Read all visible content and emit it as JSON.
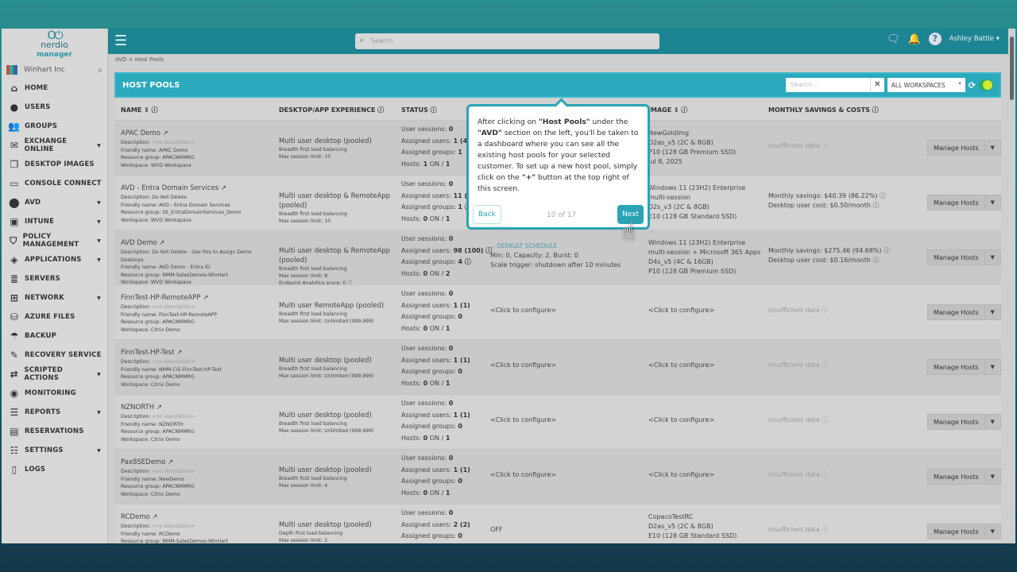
{
  "brand": {
    "logo_text": "nerdio",
    "logo_sub": "manager"
  },
  "tenant": "Winhart Inc",
  "nav": [
    {
      "label": "HOME",
      "icon": "⌂",
      "n": "home-icon"
    },
    {
      "label": "USERS",
      "icon": "●",
      "n": "user-icon"
    },
    {
      "label": "GROUPS",
      "icon": "👥",
      "n": "groups-icon"
    },
    {
      "label": "EXCHANGE ONLINE",
      "icon": "✉",
      "n": "mail-icon",
      "caret": true
    },
    {
      "label": "DESKTOP IMAGES",
      "icon": "❐",
      "n": "images-icon"
    },
    {
      "label": "CONSOLE CONNECT",
      "icon": "▭",
      "n": "monitor-icon"
    },
    {
      "label": "AVD",
      "icon": "⬤",
      "n": "avd-icon",
      "caret": true
    },
    {
      "label": "INTUNE",
      "icon": "▣",
      "n": "intune-icon",
      "caret": true
    },
    {
      "label": "POLICY MANAGEMENT",
      "icon": "⛉",
      "n": "shield-icon",
      "caret": true
    },
    {
      "label": "APPLICATIONS",
      "icon": "◈",
      "n": "apps-icon",
      "caret": true
    },
    {
      "label": "SERVERS",
      "icon": "≣",
      "n": "servers-icon"
    },
    {
      "label": "NETWORK",
      "icon": "⊞",
      "n": "network-icon",
      "caret": true
    },
    {
      "label": "AZURE FILES",
      "icon": "⛁",
      "n": "database-icon"
    },
    {
      "label": "BACKUP",
      "icon": "☂",
      "n": "umbrella-icon"
    },
    {
      "label": "RECOVERY SERVICE",
      "icon": "✎",
      "n": "wrench-icon"
    },
    {
      "label": "SCRIPTED ACTIONS",
      "icon": "⇄",
      "n": "scripts-icon",
      "caret": true
    },
    {
      "label": "MONITORING",
      "icon": "◉",
      "n": "monitoring-icon"
    },
    {
      "label": "REPORTS",
      "icon": "☰",
      "n": "reports-icon",
      "caret": true
    },
    {
      "label": "RESERVATIONS",
      "icon": "▤",
      "n": "reservations-icon"
    },
    {
      "label": "SETTINGS",
      "icon": "☷",
      "n": "settings-icon",
      "caret": true
    },
    {
      "label": "LOGS",
      "icon": "▯",
      "n": "logs-icon"
    }
  ],
  "topbar": {
    "search_placeholder": "Search",
    "user": "Ashley Battle"
  },
  "breadcrumb": "AVD  >  Host Pools",
  "panel": {
    "title": "HOST POOLS",
    "search_placeholder": "Search...",
    "workspace": "ALL WORKSPACES"
  },
  "columns": [
    "NAME ⇕ ⓘ",
    "DESKTOP/APP EXPERIENCE ⓘ",
    "STATUS ⓘ",
    "IMAGE ⇕ ⓘ",
    "MONTHLY SAVINGS & COSTS ⓘ"
  ],
  "manage_label": "Manage Hosts",
  "rows": [
    {
      "name": "APAC Demo",
      "desc": "<no description>",
      "nodesc": true,
      "friendly": "Friendly name: APAC Demo",
      "rg": "Resource group: APACNMMRG",
      "ws": "Workspace: WVD Workspace",
      "exp": "Multi user desktop (pooled)",
      "lb": "Breadth first load balancing",
      "max": "Max session limit: 10",
      "extra": "",
      "sessions": "0",
      "users": "1 (4)",
      "groups": "1",
      "hosts_on": "1",
      "hosts": "1",
      "auto": [],
      "image": [
        "NewGoldImg",
        "D2as_v5 (2C & 8GB)",
        "P10 (128 GB Premium SSD)",
        "Jul 8, 2025"
      ],
      "sav": [
        "Insufficient data ⓘ"
      ],
      "insuf": true
    },
    {
      "name": "AVD - Entra Domain Services",
      "desc": "Do Not Delete",
      "friendly": "Friendly name: AVD - Entra Domain Services",
      "rg": "Resource group: SE_EntraDomainServices_Demo",
      "ws": "Workspace: WVD Workspace",
      "exp": "Multi user desktop & RemoteApp (pooled)",
      "lb": "Breadth first load balancing",
      "max": "Max session limit: 10",
      "extra": "",
      "sessions": "0",
      "users": "11 (14)",
      "groups": "1 ⓘ",
      "hosts_on": "0",
      "hosts": "1",
      "auto": [],
      "image": [
        "Windows 11 (23H2) Enterprise multi-session",
        "D2s_v3 (2C & 8GB)",
        "E10 (128 GB Standard SSD)"
      ],
      "sav": [
        "Monthly savings: $40.39 (86.22%) ⓘ",
        "Desktop user cost: $0.50/month ⓘ"
      ]
    },
    {
      "name": "AVD Demo",
      "desc": "Do Not Delete - Use this to Assign Demo Desktops",
      "friendly": "Friendly name: AVD Demo - Entra ID",
      "rg": "Resource group: NMM-SalesDemos-WinHart",
      "ws": "Workspace: WVD Workspace",
      "exp": "Multi user desktop & RemoteApp (pooled)",
      "lb": "Breadth first load balancing",
      "max": "Max session limit: 8",
      "extra": "Endpoint Analytics score: 0 ⓘ",
      "sessions": "0",
      "users": "98 (100) ⓘ",
      "groups": "4 ⓘ",
      "hosts_on": "0",
      "hosts": "2",
      "auto": [
        "⌄ DEFAULT SCHEDULE",
        "Min: 0, Capacity: 2, Burst: 0",
        "Scale trigger: shutdown after 10 minutes"
      ],
      "image": [
        "Windows 11 (23H2) Enterprise multi-session + Microsoft 365 Apps",
        "D4s_v5 (4C & 16GB)",
        "P10 (128 GB Premium SSD)"
      ],
      "sav": [
        "Monthly savings: $275.46 (94.68%) ⓘ",
        "Desktop user cost: $0.16/month ⓘ"
      ]
    },
    {
      "name": "FinnTest-HP-RemoteAPP",
      "desc": "<no description>",
      "nodesc": true,
      "friendly": "Friendly name: FinnTest-HP-RemoteAPP",
      "rg": "Resource group: APACNMMRG",
      "ws": "Workspace: Citrix Demo",
      "exp": "Multi user RemoteApp (pooled)",
      "lb": "Breadth first load balancing",
      "max": "Max session limit: Unlimited (999,999)",
      "extra": "",
      "sessions": "0",
      "users": "1 (1)",
      "groups": "0",
      "hosts_on": "0",
      "hosts": "1",
      "auto": [
        "<Click to configure>"
      ],
      "image": [
        "<Click to configure>"
      ],
      "sav": [
        "Insufficient data ⓘ"
      ],
      "insuf": true
    },
    {
      "name": "FinnTest-HP-Test",
      "desc": "<no description>",
      "nodesc": true,
      "friendly": "Friendly name: NMM-CIS-FinnTest-HP-Test",
      "rg": "Resource group: APACNMMRG",
      "ws": "Workspace: Citrix Demo",
      "exp": "Multi user desktop (pooled)",
      "lb": "Breadth first load balancing",
      "max": "Max session limit: Unlimited (999,999)",
      "extra": "",
      "sessions": "0",
      "users": "1 (1)",
      "groups": "0",
      "hosts_on": "0",
      "hosts": "1",
      "auto": [
        "<Click to configure>"
      ],
      "image": [
        "<Click to configure>"
      ],
      "sav": [
        "Insufficient data ⓘ"
      ],
      "insuf": true
    },
    {
      "name": "NZNORTH",
      "desc": "<no description>",
      "nodesc": true,
      "friendly": "Friendly name: NZNORTH",
      "rg": "Resource group: APACNMMRG",
      "ws": "Workspace: Citrix Demo",
      "exp": "Multi user desktop (pooled)",
      "lb": "Breadth first load balancing",
      "max": "Max session limit: Unlimited (999,999)",
      "extra": "",
      "sessions": "0",
      "users": "1 (1)",
      "groups": "0",
      "hosts_on": "0",
      "hosts": "1",
      "auto": [
        "<Click to configure>"
      ],
      "image": [
        "<Click to configure>"
      ],
      "sav": [
        "Insufficient data ⓘ"
      ],
      "insuf": true
    },
    {
      "name": "Pax8SEDemo",
      "desc": "<no description>",
      "nodesc": true,
      "friendly": "Friendly name: NewDemo",
      "rg": "Resource group: APACNMMRG",
      "ws": "Workspace: Citrix Demo",
      "exp": "Multi user desktop (pooled)",
      "lb": "Breadth first load balancing",
      "max": "Max session limit: 4",
      "extra": "",
      "sessions": "0",
      "users": "1 (1)",
      "groups": "0",
      "hosts_on": "0",
      "hosts": "1",
      "auto": [
        "<Click to configure>"
      ],
      "image": [
        "<Click to configure>"
      ],
      "sav": [
        "Insufficient data ⓘ"
      ],
      "insuf": true
    },
    {
      "name": "RCDemo",
      "desc": "<no description>",
      "nodesc": true,
      "friendly": "Friendly name: RCDemo",
      "rg": "Resource group: NMM-SalesDemos-WinHart",
      "ws": "",
      "exp": "Multi user desktop (pooled)",
      "lb": "Depth first load balancing",
      "max": "Max session limit: 2",
      "extra": "",
      "sessions": "0",
      "users": "2 (2)",
      "groups": "0",
      "hosts_on": "",
      "hosts": "",
      "auto": [
        "OFF"
      ],
      "image": [
        "CopacoTestRC",
        "D2as_v5 (2C & 8GB)",
        "E10 (128 GB Standard SSD)"
      ],
      "sav": [
        "Insufficient data ⓘ"
      ],
      "insuf": true
    }
  ],
  "tooltip": {
    "pre1": "After clicking on ",
    "b1": "\"Host Pools\"",
    "mid1": " under the ",
    "b2": "\"AVD\"",
    "mid2": " section on the left, you'll be taken to a dashboard where you can see all the existing host pools for your selected customer. To set up a new host pool, simply click on the ",
    "b3": "\"+\"",
    "post": " button at the top right of this screen.",
    "back": "Back",
    "step": "10 of 17",
    "next": "Next"
  },
  "colors": {
    "accent": "#2aa4b4",
    "topbar": "#1d8494"
  }
}
